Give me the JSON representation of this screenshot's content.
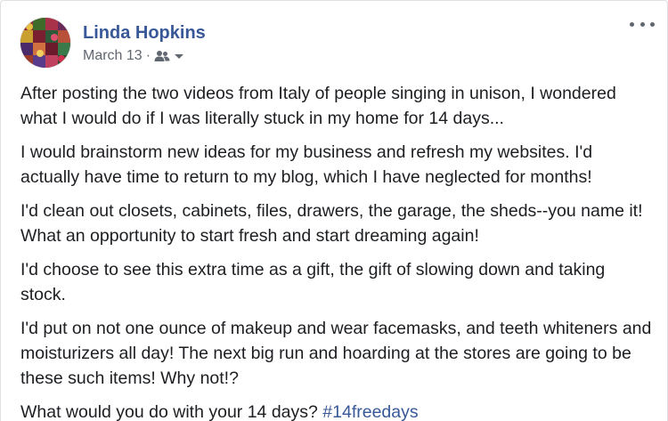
{
  "post": {
    "author": "Linda Hopkins",
    "date": "March 13",
    "separator": "·",
    "audience_icon": "friends-icon",
    "audience_dropdown_icon": "caret-down-icon",
    "more_icon": "more-options-icon",
    "paragraphs": [
      "After posting the two videos from Italy of people singing in unison, I wondered what I would do if I was literally stuck in my home for 14 days...",
      "I would brainstorm new ideas for my business and refresh my websites. I'd actually have time to return to my blog, which I have neglected for months!",
      "I'd clean out closets, cabinets, files, drawers, the garage, the sheds--you name it! What an opportunity to start fresh and start dreaming again!",
      "I'd choose to see this extra time as a gift, the gift of slowing down and taking stock.",
      "I'd put on not one ounce of makeup and wear facemasks, and teeth whiteners and moisturizers all day! The next big run and hoarding at the stores are going to be these such items! Why not!?"
    ],
    "last_line_text": "What would you do with your 14 days?",
    "hashtag": "#14freedays"
  },
  "colors": {
    "author_link": "#385898",
    "meta_text": "#616770",
    "body_text": "#1c1e21"
  }
}
